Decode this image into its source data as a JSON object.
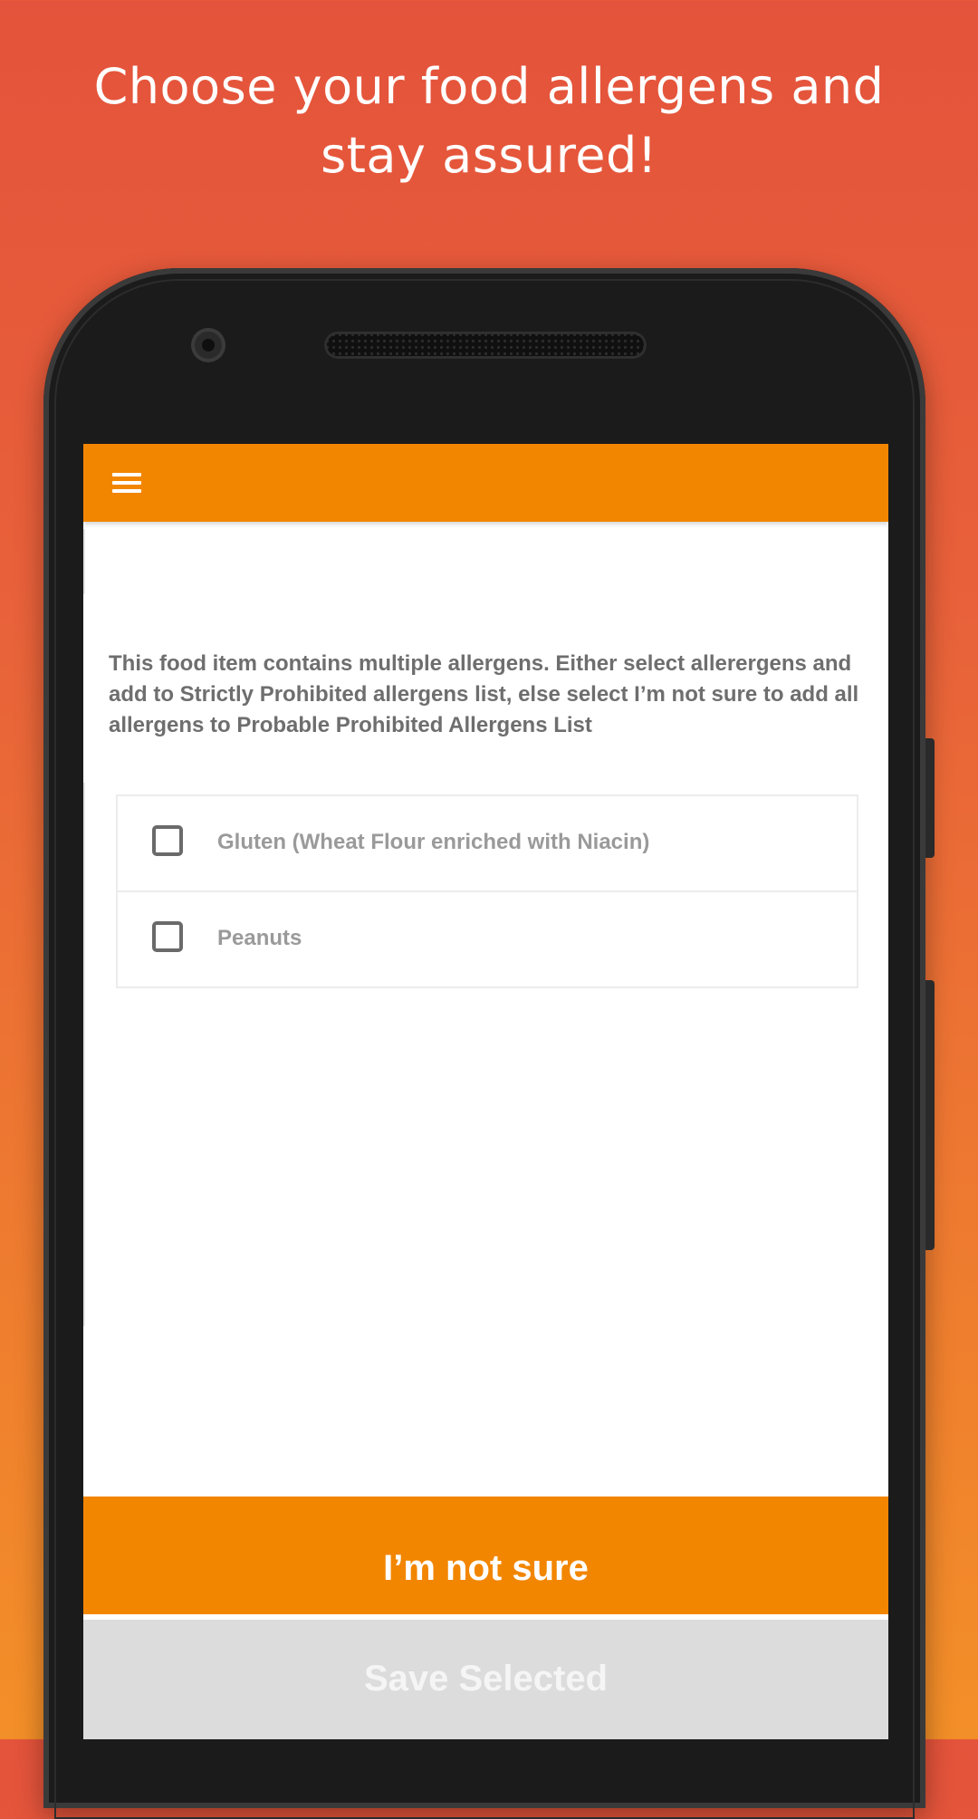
{
  "promo": {
    "headline": "Choose your food allergens and stay assured!"
  },
  "app_bar": {
    "menu_icon": "hamburger-menu-icon",
    "color": "#f28600"
  },
  "main": {
    "info_text": "This food item contains multiple allergens. Either select allerergens and add to Strictly Prohibited allergens list, else select I’m not sure to add all allergens to Probable Prohibited Allergens List",
    "allergens": [
      {
        "label": "Gluten (Wheat Flour enriched with Niacin)",
        "checked": false
      },
      {
        "label": "Peanuts",
        "checked": false
      }
    ]
  },
  "actions": {
    "not_sure_label": "I’m not sure",
    "save_label": "Save Selected"
  }
}
